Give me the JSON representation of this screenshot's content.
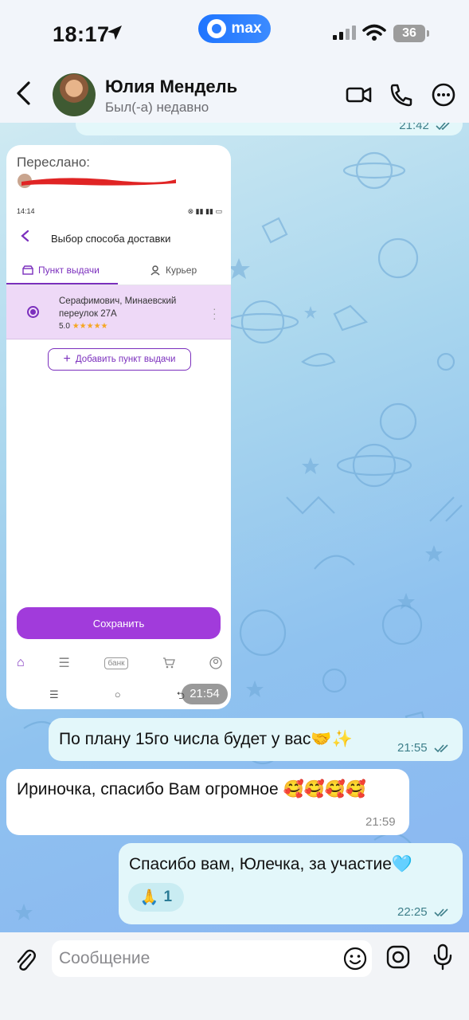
{
  "status_bar": {
    "time": "18:17",
    "app_pill": "max",
    "battery": "36"
  },
  "header": {
    "contact_name": "Юлия Мендель",
    "contact_status": "Был(-а) недавно"
  },
  "messages": {
    "previous_time": "21:42",
    "forwarded": {
      "label": "Переслано:",
      "time": "21:54",
      "screenshot": {
        "status_time": "14:14",
        "title": "Выбор способа доставки",
        "tab_pickup": "Пункт выдачи",
        "tab_courier": "Курьер",
        "pickup_address": "Серафимович, Минаевский переулок 27А",
        "pickup_rating": "5.0",
        "pickup_stars": "★★★★★",
        "add_pickup": "Добавить пункт выдачи",
        "save": "Сохранить",
        "nav_bank": "банк"
      }
    },
    "msg1": {
      "text": "По плану 15го числа будет у вас🤝✨",
      "time": "21:55"
    },
    "msg2": {
      "text": "Ириночка, спасибо Вам огромное 🥰🥰🥰🥰",
      "time": "21:59"
    },
    "msg3": {
      "text": "Спасибо вам, Юлечка, за участие🩵",
      "time": "22:25",
      "reaction_emoji": "🙏",
      "reaction_count": "1"
    }
  },
  "input": {
    "placeholder": "Сообщение"
  },
  "colors": {
    "accent": "#1e74ff",
    "outgoing_bubble": "#e3f7fa",
    "incoming_bubble": "#ffffff",
    "purple": "#a13bdb"
  }
}
